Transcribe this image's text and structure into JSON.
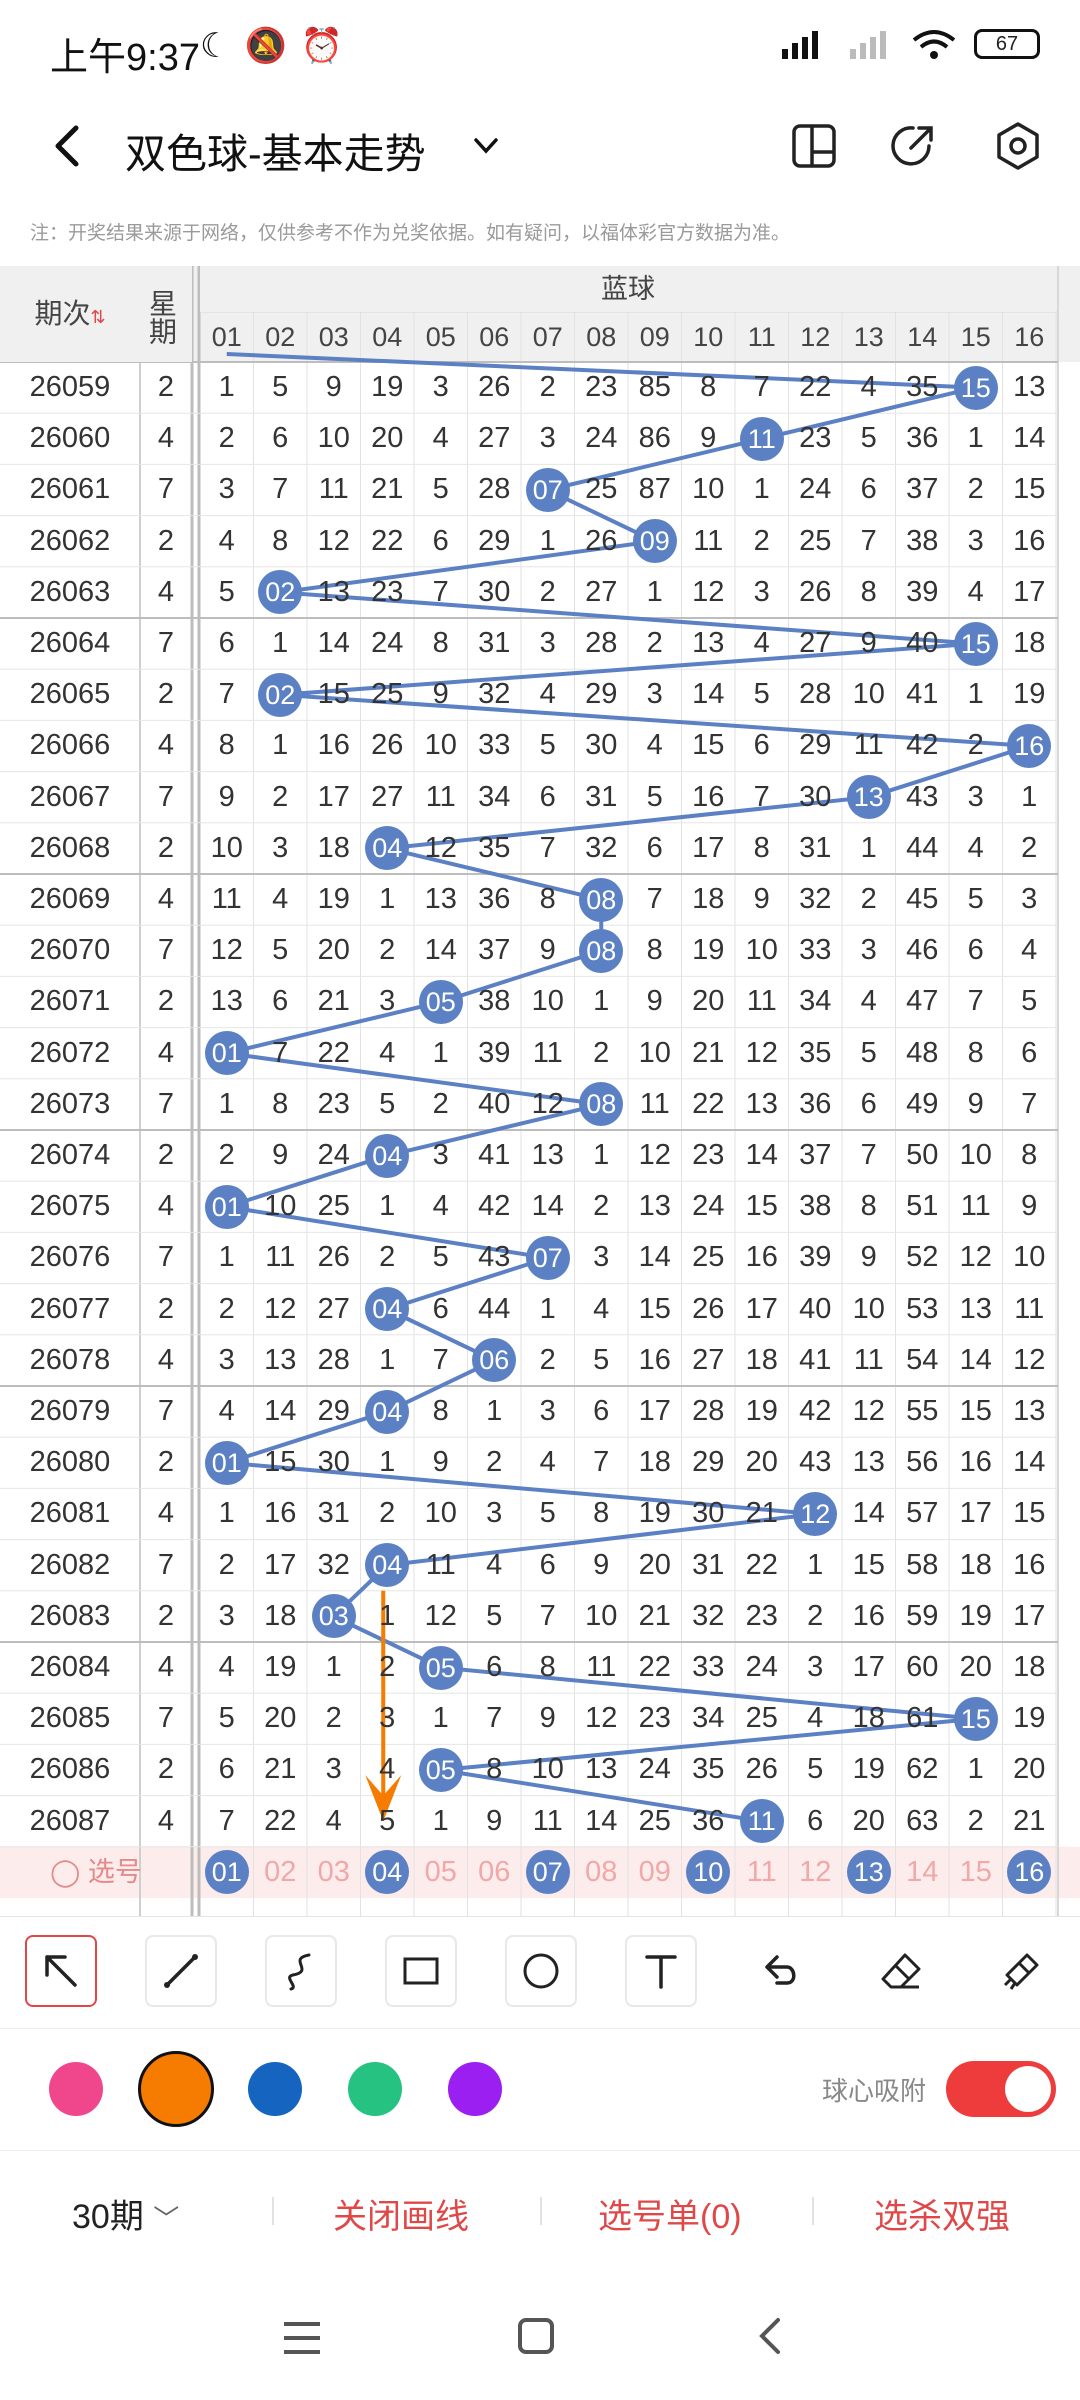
{
  "status_bar": {
    "time": "上午9:37",
    "battery": "67"
  },
  "header": {
    "title": "双色球-基本走势"
  },
  "notice": "注：开奖结果来源于网络，仅供参考不作为兑奖依据。如有疑问，以福体彩官方数据为准。",
  "table": {
    "col_period": "期次",
    "col_week": "星期",
    "group_label": "蓝球",
    "numbers": [
      "01",
      "02",
      "03",
      "04",
      "05",
      "06",
      "07",
      "08",
      "09",
      "10",
      "11",
      "12",
      "13",
      "14",
      "15",
      "16"
    ],
    "rows": [
      {
        "period": "26059",
        "week": "2",
        "hit": 15,
        "cells": [
          "1",
          "5",
          "9",
          "19",
          "3",
          "26",
          "2",
          "23",
          "85",
          "8",
          "7",
          "22",
          "4",
          "35",
          "15",
          "13"
        ]
      },
      {
        "period": "26060",
        "week": "4",
        "hit": 11,
        "cells": [
          "2",
          "6",
          "10",
          "20",
          "4",
          "27",
          "3",
          "24",
          "86",
          "9",
          "11",
          "23",
          "5",
          "36",
          "1",
          "14"
        ]
      },
      {
        "period": "26061",
        "week": "7",
        "hit": 7,
        "cells": [
          "3",
          "7",
          "11",
          "21",
          "5",
          "28",
          "07",
          "25",
          "87",
          "10",
          "1",
          "24",
          "6",
          "37",
          "2",
          "15"
        ]
      },
      {
        "period": "26062",
        "week": "2",
        "hit": 9,
        "cells": [
          "4",
          "8",
          "12",
          "22",
          "6",
          "29",
          "1",
          "26",
          "09",
          "11",
          "2",
          "25",
          "7",
          "38",
          "3",
          "16"
        ]
      },
      {
        "period": "26063",
        "week": "4",
        "hit": 2,
        "cells": [
          "5",
          "02",
          "13",
          "23",
          "7",
          "30",
          "2",
          "27",
          "1",
          "12",
          "3",
          "26",
          "8",
          "39",
          "4",
          "17"
        ]
      },
      {
        "period": "26064",
        "week": "7",
        "hit": 15,
        "cells": [
          "6",
          "1",
          "14",
          "24",
          "8",
          "31",
          "3",
          "28",
          "2",
          "13",
          "4",
          "27",
          "9",
          "40",
          "15",
          "18"
        ]
      },
      {
        "period": "26065",
        "week": "2",
        "hit": 2,
        "cells": [
          "7",
          "02",
          "15",
          "25",
          "9",
          "32",
          "4",
          "29",
          "3",
          "14",
          "5",
          "28",
          "10",
          "41",
          "1",
          "19"
        ]
      },
      {
        "period": "26066",
        "week": "4",
        "hit": 16,
        "cells": [
          "8",
          "1",
          "16",
          "26",
          "10",
          "33",
          "5",
          "30",
          "4",
          "15",
          "6",
          "29",
          "11",
          "42",
          "2",
          "16"
        ]
      },
      {
        "period": "26067",
        "week": "7",
        "hit": 13,
        "cells": [
          "9",
          "2",
          "17",
          "27",
          "11",
          "34",
          "6",
          "31",
          "5",
          "16",
          "7",
          "30",
          "13",
          "43",
          "3",
          "1"
        ]
      },
      {
        "period": "26068",
        "week": "2",
        "hit": 4,
        "cells": [
          "10",
          "3",
          "18",
          "04",
          "12",
          "35",
          "7",
          "32",
          "6",
          "17",
          "8",
          "31",
          "1",
          "44",
          "4",
          "2"
        ]
      },
      {
        "period": "26069",
        "week": "4",
        "hit": 8,
        "cells": [
          "11",
          "4",
          "19",
          "1",
          "13",
          "36",
          "8",
          "08",
          "7",
          "18",
          "9",
          "32",
          "2",
          "45",
          "5",
          "3"
        ]
      },
      {
        "period": "26070",
        "week": "7",
        "hit": 8,
        "cells": [
          "12",
          "5",
          "20",
          "2",
          "14",
          "37",
          "9",
          "08",
          "8",
          "19",
          "10",
          "33",
          "3",
          "46",
          "6",
          "4"
        ]
      },
      {
        "period": "26071",
        "week": "2",
        "hit": 5,
        "cells": [
          "13",
          "6",
          "21",
          "3",
          "05",
          "38",
          "10",
          "1",
          "9",
          "20",
          "11",
          "34",
          "4",
          "47",
          "7",
          "5"
        ]
      },
      {
        "period": "26072",
        "week": "4",
        "hit": 1,
        "cells": [
          "01",
          "7",
          "22",
          "4",
          "1",
          "39",
          "11",
          "2",
          "10",
          "21",
          "12",
          "35",
          "5",
          "48",
          "8",
          "6"
        ]
      },
      {
        "period": "26073",
        "week": "7",
        "hit": 8,
        "cells": [
          "1",
          "8",
          "23",
          "5",
          "2",
          "40",
          "12",
          "08",
          "11",
          "22",
          "13",
          "36",
          "6",
          "49",
          "9",
          "7"
        ]
      },
      {
        "period": "26074",
        "week": "2",
        "hit": 4,
        "cells": [
          "2",
          "9",
          "24",
          "04",
          "3",
          "41",
          "13",
          "1",
          "12",
          "23",
          "14",
          "37",
          "7",
          "50",
          "10",
          "8"
        ]
      },
      {
        "period": "26075",
        "week": "4",
        "hit": 1,
        "cells": [
          "01",
          "10",
          "25",
          "1",
          "4",
          "42",
          "14",
          "2",
          "13",
          "24",
          "15",
          "38",
          "8",
          "51",
          "11",
          "9"
        ]
      },
      {
        "period": "26076",
        "week": "7",
        "hit": 7,
        "cells": [
          "1",
          "11",
          "26",
          "2",
          "5",
          "43",
          "07",
          "3",
          "14",
          "25",
          "16",
          "39",
          "9",
          "52",
          "12",
          "10"
        ]
      },
      {
        "period": "26077",
        "week": "2",
        "hit": 4,
        "cells": [
          "2",
          "12",
          "27",
          "04",
          "6",
          "44",
          "1",
          "4",
          "15",
          "26",
          "17",
          "40",
          "10",
          "53",
          "13",
          "11"
        ]
      },
      {
        "period": "26078",
        "week": "4",
        "hit": 6,
        "cells": [
          "3",
          "13",
          "28",
          "1",
          "7",
          "06",
          "2",
          "5",
          "16",
          "27",
          "18",
          "41",
          "11",
          "54",
          "14",
          "12"
        ]
      },
      {
        "period": "26079",
        "week": "7",
        "hit": 4,
        "cells": [
          "4",
          "14",
          "29",
          "04",
          "8",
          "1",
          "3",
          "6",
          "17",
          "28",
          "19",
          "42",
          "12",
          "55",
          "15",
          "13"
        ]
      },
      {
        "period": "26080",
        "week": "2",
        "hit": 1,
        "cells": [
          "01",
          "15",
          "30",
          "1",
          "9",
          "2",
          "4",
          "7",
          "18",
          "29",
          "20",
          "43",
          "13",
          "56",
          "16",
          "14"
        ]
      },
      {
        "period": "26081",
        "week": "4",
        "hit": 12,
        "cells": [
          "1",
          "16",
          "31",
          "2",
          "10",
          "3",
          "5",
          "8",
          "19",
          "30",
          "21",
          "12",
          "14",
          "57",
          "17",
          "15"
        ]
      },
      {
        "period": "26082",
        "week": "7",
        "hit": 4,
        "cells": [
          "2",
          "17",
          "32",
          "04",
          "11",
          "4",
          "6",
          "9",
          "20",
          "31",
          "22",
          "1",
          "15",
          "58",
          "18",
          "16"
        ]
      },
      {
        "period": "26083",
        "week": "2",
        "hit": 3,
        "cells": [
          "3",
          "18",
          "03",
          "1",
          "12",
          "5",
          "7",
          "10",
          "21",
          "32",
          "23",
          "2",
          "16",
          "59",
          "19",
          "17"
        ]
      },
      {
        "period": "26084",
        "week": "4",
        "hit": 5,
        "cells": [
          "4",
          "19",
          "1",
          "2",
          "05",
          "6",
          "8",
          "11",
          "22",
          "33",
          "24",
          "3",
          "17",
          "60",
          "20",
          "18"
        ]
      },
      {
        "period": "26085",
        "week": "7",
        "hit": 15,
        "cells": [
          "5",
          "20",
          "2",
          "3",
          "1",
          "7",
          "9",
          "12",
          "23",
          "34",
          "25",
          "4",
          "18",
          "61",
          "15",
          "19"
        ]
      },
      {
        "period": "26086",
        "week": "2",
        "hit": 5,
        "cells": [
          "6",
          "21",
          "3",
          "4",
          "05",
          "8",
          "10",
          "13",
          "24",
          "35",
          "26",
          "5",
          "19",
          "62",
          "1",
          "20"
        ]
      },
      {
        "period": "26087",
        "week": "4",
        "hit": 11,
        "cells": [
          "7",
          "22",
          "4",
          "5",
          "1",
          "9",
          "11",
          "14",
          "25",
          "36",
          "11",
          "6",
          "20",
          "63",
          "2",
          "21"
        ]
      }
    ],
    "select_label": "选号",
    "select_picked": [
      1,
      4,
      7,
      10,
      13,
      16
    ]
  },
  "tools": [
    "pointer-tool",
    "line-tool",
    "curve-tool",
    "rectangle-tool",
    "circle-tool",
    "text-tool",
    "undo-tool",
    "eraser-tool",
    "clear-tool"
  ],
  "colors": [
    "#f0478c",
    "#f57c00",
    "#1565c0",
    "#26c281",
    "#9b1ff0"
  ],
  "magnet_label": "球心吸附",
  "bottom_bar": {
    "period": "30期",
    "close_lines": "关闭画线",
    "selection": "选号单(0)",
    "kill": "选杀双强"
  }
}
